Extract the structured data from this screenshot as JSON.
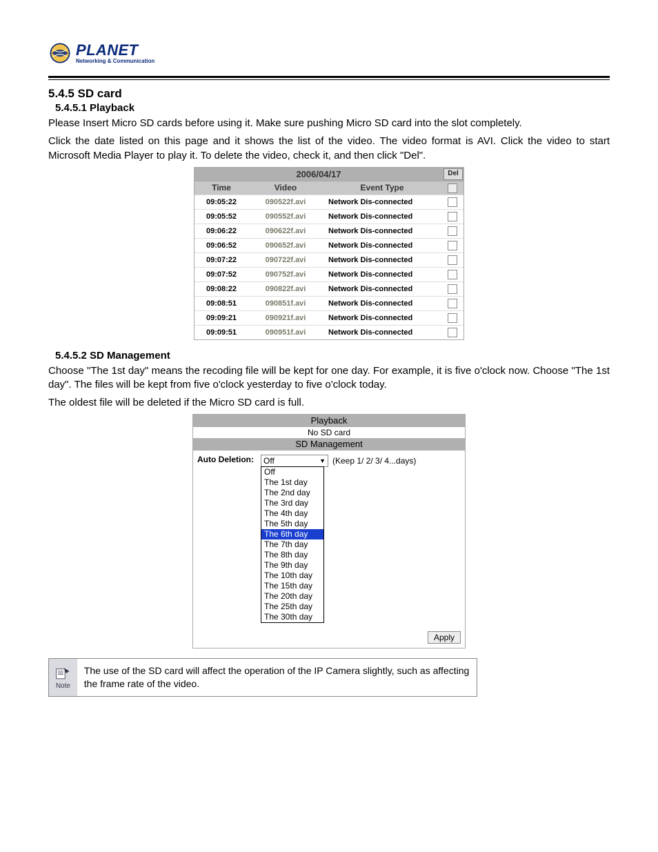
{
  "logo": {
    "brand": "PLANET",
    "tagline": "Networking & Communication"
  },
  "section": {
    "h545": "5.4.5 SD card",
    "h5451": "5.4.5.1 Playback",
    "p1": "Please Insert Micro SD cards before using it. Make sure pushing Micro SD card into the slot completely.",
    "p2": "Click the date listed on this page and it shows the list of the video. The video format is AVI. Click the video to start Microsoft Media Player to play it. To delete the video, check it, and then click \"Del\".",
    "h5452": "5.4.5.2 SD Management",
    "p3": "Choose \"The 1st day\" means the recoding file will be kept for one day. For example, it is five o'clock now. Choose \"The 1st day\". The files will be kept from five o'clock yesterday to five o'clock today.",
    "p4": "The oldest file will be deleted if the Micro SD card is full."
  },
  "playback": {
    "date": "2006/04/17",
    "del_label": "Del",
    "headers": {
      "time": "Time",
      "video": "Video",
      "event": "Event Type"
    },
    "rows": [
      {
        "time": "09:05:22",
        "video": "090522f.avi",
        "event": "Network Dis-connected"
      },
      {
        "time": "09:05:52",
        "video": "090552f.avi",
        "event": "Network Dis-connected"
      },
      {
        "time": "09:06:22",
        "video": "090622f.avi",
        "event": "Network Dis-connected"
      },
      {
        "time": "09:06:52",
        "video": "090652f.avi",
        "event": "Network Dis-connected"
      },
      {
        "time": "09:07:22",
        "video": "090722f.avi",
        "event": "Network Dis-connected"
      },
      {
        "time": "09:07:52",
        "video": "090752f.avi",
        "event": "Network Dis-connected"
      },
      {
        "time": "09:08:22",
        "video": "090822f.avi",
        "event": "Network Dis-connected"
      },
      {
        "time": "09:08:51",
        "video": "090851f.avi",
        "event": "Network Dis-connected"
      },
      {
        "time": "09:09:21",
        "video": "090921f.avi",
        "event": "Network Dis-connected"
      },
      {
        "time": "09:09:51",
        "video": "090951f.avi",
        "event": "Network Dis-connected"
      }
    ]
  },
  "sdmgmt": {
    "title_playback": "Playback",
    "no_sd": "No SD card",
    "title_mgmt": "SD Management",
    "auto_del_label": "Auto Deletion:",
    "selected": "Off",
    "hint": "(Keep 1/ 2/ 3/ 4...days)",
    "apply": "Apply",
    "options": [
      "Off",
      "The 1st day",
      "The 2nd day",
      "The 3rd day",
      "The 4th day",
      "The 5th day",
      "The 6th day",
      "The 7th day",
      "The 8th day",
      "The 9th day",
      "The 10th day",
      "The 15th day",
      "The 20th day",
      "The 25th day",
      "The 30th day"
    ],
    "highlighted_index": 6
  },
  "note": {
    "label": "Note",
    "text": "The use of the SD card will affect the operation of the IP Camera slightly, such as affecting the frame rate of the video."
  }
}
